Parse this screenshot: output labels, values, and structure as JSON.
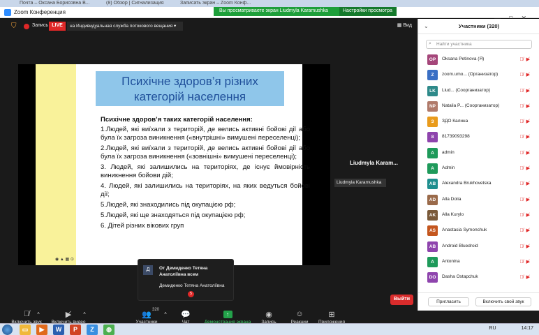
{
  "browser_tabs": [
    "Почта – Оксана Борисовна В...",
    "(8) Обзор | Сигнализация",
    "Записать экран – Zoom Конф..."
  ],
  "window": {
    "title": "Zoom Конференция"
  },
  "banner": {
    "text": "Вы просматриваете экран Liudmyla Karamushka",
    "options_label": "Настройки просмотра ⌄"
  },
  "topbar": {
    "record_label": "Запись",
    "live_badge": "LIVE",
    "live_service": "на Индивидуальная служба потокового вещания",
    "view_label": "Вид"
  },
  "slide": {
    "title": "Психічне здоров’я різних категорій населення",
    "heading": "Психічне здоров’я таких категорій населення:",
    "items": [
      "1.Людей, які виїхали з територій, де велись активні бойові дії або була їх загроза виникнення («внутрішні» вимушені переселенці);",
      "2.Людей, які виїхали з територій, де велись активні бойові дії або була їх загроза виникнення («зовнішні» вимушені переселенці);",
      "3. Людей, які залишились на територіях, де існує ймовірність виникнення бойови дій;",
      "4. Людей, які залишились на територіях, на яких ведуться бойові дії;",
      "5.Людей, які знаходились під окупацією рф;",
      "5.Людей, які ще знаходяться під окупацією рф;",
      "6. Дітей різних вікових груп"
    ]
  },
  "speaker": {
    "name": "Liudmyla Karam...",
    "tooltip": "Liudmyla Karamushka"
  },
  "chat_popup": {
    "avatar": "Д",
    "from": "От Демиденко Тетяна Анатоліївна всем",
    "message": "Демиденко Тетяна Анатоліївна"
  },
  "toolbar": {
    "mute": "Включить звук",
    "video": "Включить видео",
    "participants": "Участники",
    "participants_count": "320",
    "chat": "Чат",
    "chat_badge": "5",
    "share": "Демонстрация экрана",
    "record": "Запись",
    "reactions": "Реакции",
    "apps": "Приложения",
    "leave": "Выйти"
  },
  "panel": {
    "title": "Участники (320)",
    "search_placeholder": "Найти участника",
    "participants": [
      {
        "initials": "OP",
        "name": "Oksana Petinova (Я)",
        "color": "#a5467a"
      },
      {
        "initials": "Z",
        "name": "zoom.umo... (Организатор)",
        "color": "#3a6fc4"
      },
      {
        "initials": "LK",
        "name": "Liud... (Соорганизатор)",
        "color": "#2e8a8a"
      },
      {
        "initials": "NP",
        "name": "Natalia P... (Соорганизатор)",
        "color": "#b07a6a"
      },
      {
        "initials": "З",
        "name": "ЗДО Калина",
        "color": "#e99b1c"
      },
      {
        "initials": "8",
        "name": "81739093298",
        "color": "#8e44ad"
      },
      {
        "initials": "A",
        "name": "admin",
        "color": "#1e9a5a"
      },
      {
        "initials": "A",
        "name": "Admin",
        "color": "#1e9a5a"
      },
      {
        "initials": "AB",
        "name": "Alexandra Brukhovetska",
        "color": "#1f8f8f"
      },
      {
        "initials": "AD",
        "name": "Alla Dolia",
        "color": "#9a6a4a"
      },
      {
        "initials": "AK",
        "name": "Alla Kurylo",
        "color": "#7a5a3a"
      },
      {
        "initials": "AS",
        "name": "Anastasia Symonchuk",
        "color": "#c4561e"
      },
      {
        "initials": "AB",
        "name": "Android Bluedroid",
        "color": "#8e44ad"
      },
      {
        "initials": "A",
        "name": "Antonina",
        "color": "#1e9a5a"
      },
      {
        "initials": "DO",
        "name": "Dasha Ostapchuk",
        "color": "#8e44ad"
      }
    ],
    "invite_button": "Пригласить",
    "unmute_button": "Включить свой звук"
  },
  "taskbar": {
    "lang": "RU",
    "time": "14:17"
  }
}
